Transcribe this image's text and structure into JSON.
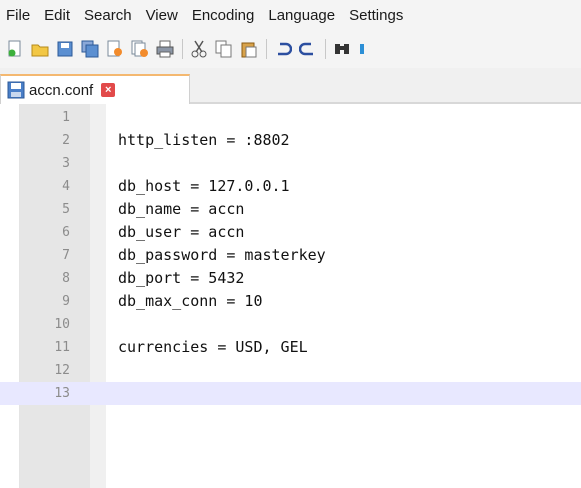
{
  "menu": {
    "items": [
      "File",
      "Edit",
      "Search",
      "View",
      "Encoding",
      "Language",
      "Settings"
    ]
  },
  "toolbar": {
    "icons": [
      "new-file-icon",
      "open-file-icon",
      "save-icon",
      "save-all-icon",
      "close-icon",
      "close-all-icon",
      "print-icon",
      "cut-icon",
      "copy-icon",
      "paste-icon",
      "undo-icon",
      "redo-icon",
      "find-icon",
      "replace-icon"
    ]
  },
  "tab": {
    "label": "accn.conf",
    "close_glyph": "×"
  },
  "editor": {
    "lines": [
      {
        "num": "1",
        "text": ""
      },
      {
        "num": "2",
        "text": "http_listen = :8802"
      },
      {
        "num": "3",
        "text": ""
      },
      {
        "num": "4",
        "text": "db_host = 127.0.0.1"
      },
      {
        "num": "5",
        "text": "db_name = accn"
      },
      {
        "num": "6",
        "text": "db_user = accn"
      },
      {
        "num": "7",
        "text": "db_password = masterkey"
      },
      {
        "num": "8",
        "text": "db_port = 5432"
      },
      {
        "num": "9",
        "text": "db_max_conn = 10"
      },
      {
        "num": "10",
        "text": ""
      },
      {
        "num": "11",
        "text": "currencies = USD, GEL"
      },
      {
        "num": "12",
        "text": ""
      },
      {
        "num": "13",
        "text": ""
      }
    ],
    "current_line": "13"
  },
  "colors": {
    "current_line_bg": "#e8e8ff",
    "tab_accent": "#f4b870",
    "close_button": "#e24a4a"
  }
}
